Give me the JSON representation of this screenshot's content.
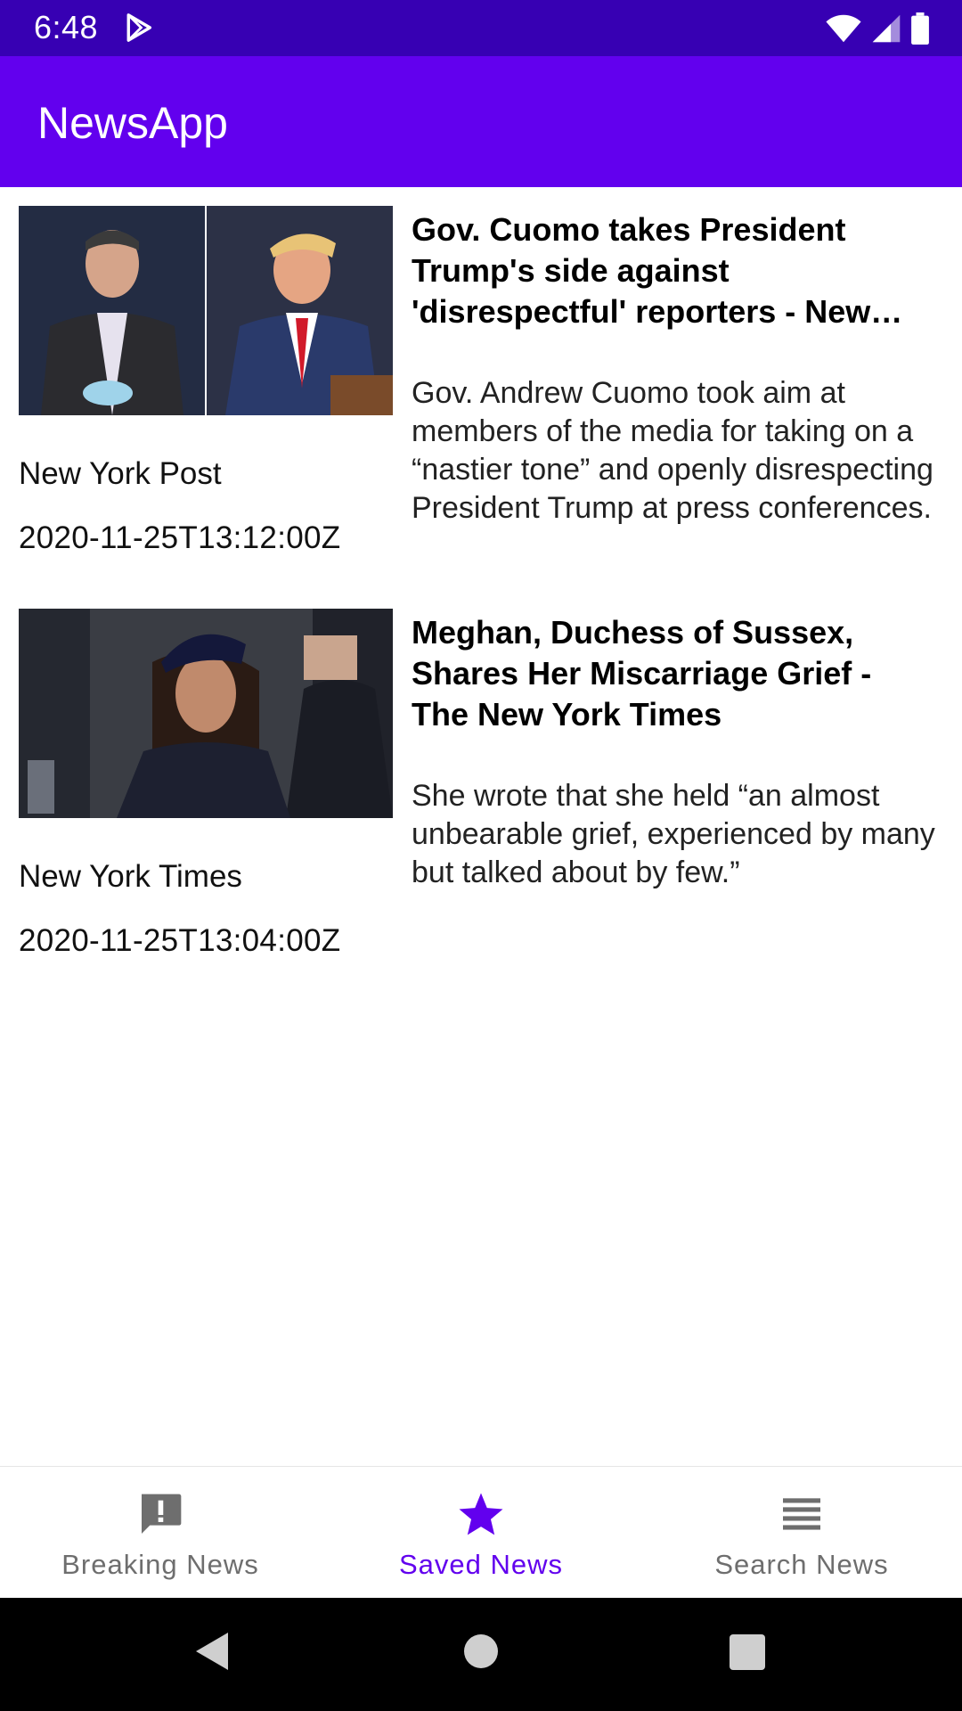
{
  "status_bar": {
    "time": "6:48"
  },
  "app_bar": {
    "title": "NewsApp"
  },
  "articles": [
    {
      "title": "Gov. Cuomo takes President Trump's side against 'disrespectful' reporters - New York Post",
      "description": "Gov. Andrew Cuomo took aim at members of the media for taking on a “nastier tone” and openly disrespecting President Trump at press conferences.",
      "source": "New York Post",
      "published_at": "2020-11-25T13:12:00Z",
      "image_icon": "photo-two-politicians"
    },
    {
      "title": "Meghan, Duchess of Sussex, Shares Her Miscarriage Grief - The New York Times",
      "description": "She wrote that she held “an almost unbearable grief, experienced by many but talked about by few.”",
      "source": "New York Times",
      "published_at": "2020-11-25T13:04:00Z",
      "image_icon": "photo-woman-in-hat"
    }
  ],
  "bottom_nav": {
    "items": [
      {
        "label": "Breaking News",
        "icon": "alert-icon",
        "active": false
      },
      {
        "label": "Saved News",
        "icon": "star-icon",
        "active": true
      },
      {
        "label": "Search News",
        "icon": "list-icon",
        "active": false
      }
    ]
  },
  "colors": {
    "status_bar": "#3700B3",
    "primary": "#6200EE",
    "nav_inactive": "#6E6E6E"
  }
}
